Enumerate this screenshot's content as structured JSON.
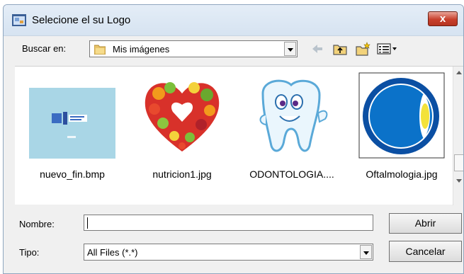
{
  "window": {
    "title": "Selecione el su Logo",
    "close_label": "x"
  },
  "location": {
    "label": "Buscar en:",
    "value": "Mis imágenes"
  },
  "files": [
    {
      "name": "nuevo_fin.bmp",
      "thumb_icon": "image-thumbnail-icon"
    },
    {
      "name": "nutricion1.jpg",
      "thumb_icon": "fruit-heart-thumbnail-icon"
    },
    {
      "name": "ODONTOLOGIA....",
      "thumb_icon": "tooth-cartoon-thumbnail-icon"
    },
    {
      "name": "Oftalmologia.jpg",
      "thumb_icon": "eye-logo-thumbnail-icon"
    }
  ],
  "filename": {
    "label": "Nombre:",
    "value": ""
  },
  "filetype": {
    "label": "Tipo:",
    "value": "All Files (*.*)"
  },
  "buttons": {
    "open": "Abrir",
    "cancel": "Cancelar"
  },
  "colors": {
    "title_bar": "#dbe6f3",
    "close_button": "#c8402c",
    "dialog_bg": "#f0f0f0"
  }
}
